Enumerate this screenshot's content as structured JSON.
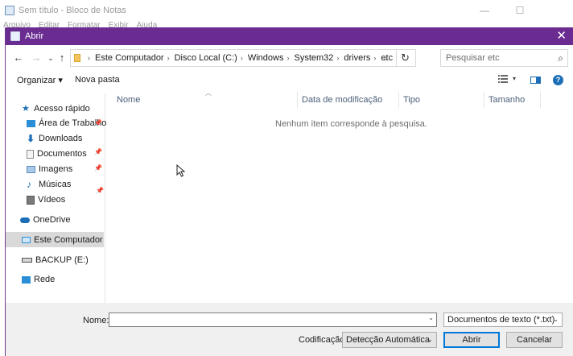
{
  "notepad": {
    "title": "Sem título - Bloco de Notas",
    "minimize": "—",
    "maximize": "☐",
    "menu": [
      "Arquivo",
      "Editar",
      "Formatar",
      "Exibir",
      "Ajuda"
    ]
  },
  "dialog": {
    "title": "Abrir",
    "close": "✕",
    "nav": {
      "back": "←",
      "forward": "→",
      "recent": "⌄",
      "up": "↑",
      "refresh": "↻"
    },
    "breadcrumb": [
      "Este Computador",
      "Disco Local (C:)",
      "Windows",
      "System32",
      "drivers",
      "etc"
    ],
    "search_placeholder": "Pesquisar etc",
    "toolbar": {
      "organize": "Organizar ▾",
      "new_folder": "Nova pasta",
      "help": "?"
    },
    "navpane": {
      "quick_access": "Acesso rápido",
      "quick_items": [
        "Área de Trabalho",
        "Downloads",
        "Documentos",
        "Imagens",
        "Músicas",
        "Vídeos"
      ],
      "onedrive": "OneDrive",
      "this_pc": "Este Computador",
      "backup": "BACKUP (E:)",
      "network": "Rede"
    },
    "columns": [
      "Nome",
      "Data de modificação",
      "Tipo",
      "Tamanho"
    ],
    "empty_message": "Nenhum item corresponde à pesquisa.",
    "bottom": {
      "name_label": "Nome:",
      "name_value": "",
      "file_type": "Documentos de texto (*.txt)",
      "encoding_label": "Codificação:",
      "encoding": "Detecção Automática",
      "open": "Abrir",
      "cancel": "Cancelar"
    }
  },
  "colors": {
    "titlebar": "#6a2c91",
    "accent": "#0078d7",
    "selected": "#d9d9d9"
  }
}
